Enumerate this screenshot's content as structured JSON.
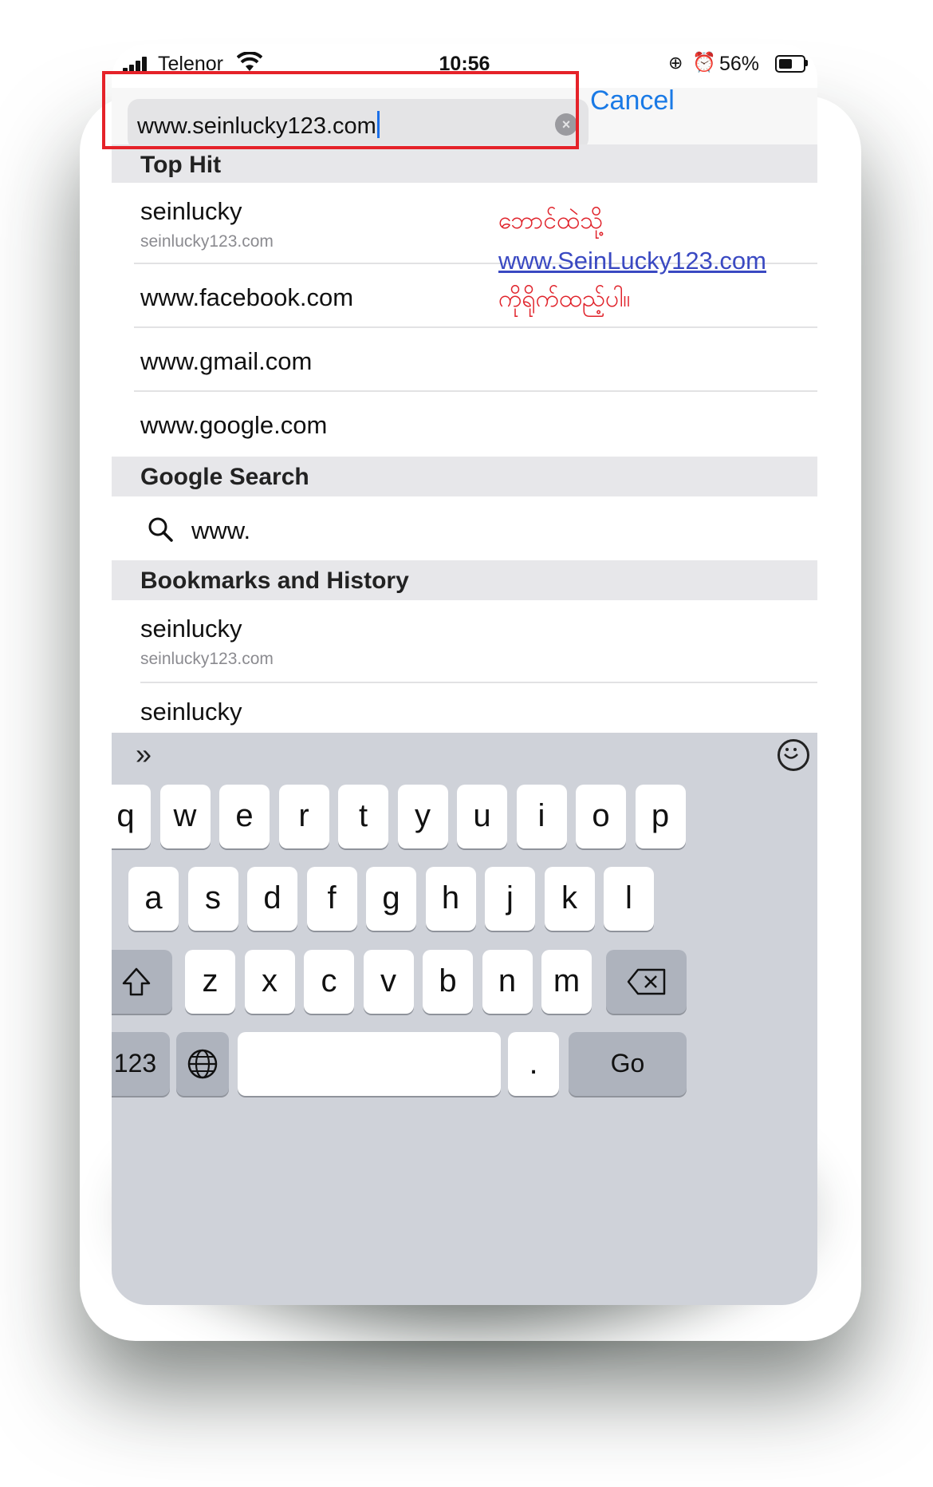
{
  "status_bar": {
    "carrier": "Telenor",
    "time": "10:56",
    "battery_percent": "56%",
    "battery_level": 0.56,
    "icons": [
      "signal-icon",
      "wifi-icon",
      "rotation-lock-icon",
      "alarm-icon",
      "battery-icon"
    ]
  },
  "address_bar": {
    "value": "www.seinlucky123.com",
    "cancel_label": "Cancel"
  },
  "annotation": {
    "line1": "ဘောင်ထဲသို့",
    "link": "www.SeinLucky123.com",
    "line2": "ကိုရိုက်ထည့်ပါ။",
    "highlight_color": "#e52229"
  },
  "suggestions": {
    "top_hit_header": "Top Hit",
    "top_hit": {
      "title": "seinlucky",
      "subtitle": "seinlucky123.com"
    },
    "other_sites": [
      "www.facebook.com",
      "www.gmail.com",
      "www.google.com"
    ],
    "google_search_header": "Google Search",
    "google_query": "www.",
    "bookmarks_header": "Bookmarks and History",
    "bookmarks": [
      {
        "title": "seinlucky",
        "subtitle": "seinlucky123.com"
      },
      {
        "title": "seinlucky",
        "subtitle": ""
      }
    ]
  },
  "keyboard": {
    "row1": [
      "q",
      "w",
      "e",
      "r",
      "t",
      "y",
      "u",
      "i",
      "o",
      "p"
    ],
    "row2": [
      "a",
      "s",
      "d",
      "f",
      "g",
      "h",
      "j",
      "k",
      "l"
    ],
    "row3": [
      "z",
      "x",
      "c",
      "v",
      "b",
      "n",
      "m"
    ],
    "numbers_label": "123",
    "dot_label": ".",
    "go_label": "Go",
    "toolbar_chevron": "»"
  },
  "colors": {
    "accent": "#1a7ae6",
    "annotation_text": "#e0232b",
    "annotation_link": "#3a49c2"
  }
}
